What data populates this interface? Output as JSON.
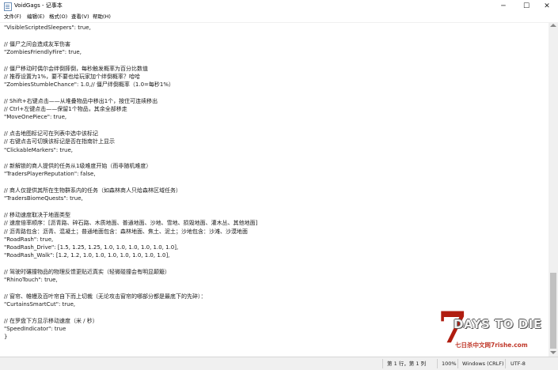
{
  "window": {
    "title": "VoidGags - 记事本",
    "minimize": "─",
    "maximize": "☐",
    "close": "✕"
  },
  "menu": [
    "文件(F)",
    "编辑(E)",
    "格式(O)",
    "查看(V)",
    "帮助(H)"
  ],
  "lines": [
    "\"VisibleScriptedSleepers\": true,",
    "",
    "// 僵尸之间会造成友军伤害",
    "\"ZombiesFriendlyFire\": true,",
    "",
    "// 僵尸移动时偶尔会绊倒摔倒，每秒触发概率为百分比数值",
    "// 推荐设置为1%，要不要也给玩家加个绊倒概率？哈哈",
    "\"ZombiesStumbleChance\": 1.0,// 僵尸绊倒概率（1.0=每秒1%）",
    "",
    "// Shift+右键点击——从堆叠物品中移出1个，按住可连续移出",
    "// Ctrl+左键点击——保留1个物品，其余全部移走",
    "\"MoveOnePiece\": true,",
    "",
    "// 点击地图标记可在列表中选中该标记",
    "// 右键点击可切换该标记是否在指南针上显示",
    "\"ClickableMarkers\": true,",
    "",
    "// 新解锁的商人提供的任务从1级难度开始（而非随机难度）",
    "\"TradersPlayerReputation\": false,",
    "",
    "// 商人仅提供其所在生物群系内的任务（如森林商人只给森林区域任务）",
    "\"TradersBiomeQuests\": true,",
    "",
    "// 移动速度取决于地面类型",
    "// 速度倍率顺序：[沥青路、碎石路、木质地面、普通地面、沙地、雪地、损毁地面、灌木丛、其他地面]",
    "// 沥青路包含：沥青、混凝土；普通地面包含：森林地面、焦土、泥土；沙地包含：沙滩、沙漠地面",
    "\"RoadRash\": true,",
    "\"RoadRash_Drive\": [1.5, 1.25, 1.25, 1.0, 1.0, 1.0, 1.0, 1.0, 1.0],",
    "\"RoadRash_Walk\": [1.2, 1.2, 1.0, 1.0, 1.0, 1.0, 1.0, 1.0, 1.0],",
    "",
    "// 驾驶时碾撞物品的物理反馈更贴近真实（轻微碰撞会有明显颠簸）",
    "\"RhinoTouch\": true,",
    "",
    "// 窗帘、帷幔及百叶帘自下而上切裁（无论攻击窗帘的哪部分都是最底下的先碎）：",
    "\"CurtainsSmartCut\": true,",
    "",
    "// 在罗盘下方显示移动速度（米 / 秒）",
    "\"SpeedIndicator\": true",
    "}"
  ],
  "status": {
    "position": "第 1 行，第 1 列",
    "zoom": "100%",
    "line_ending": "Windows (CRLF)",
    "encoding": "UTF-8"
  },
  "logo": {
    "seven": "7",
    "text": "DAYS TO DIE",
    "site": "七日杀中文网7rishe.com"
  }
}
